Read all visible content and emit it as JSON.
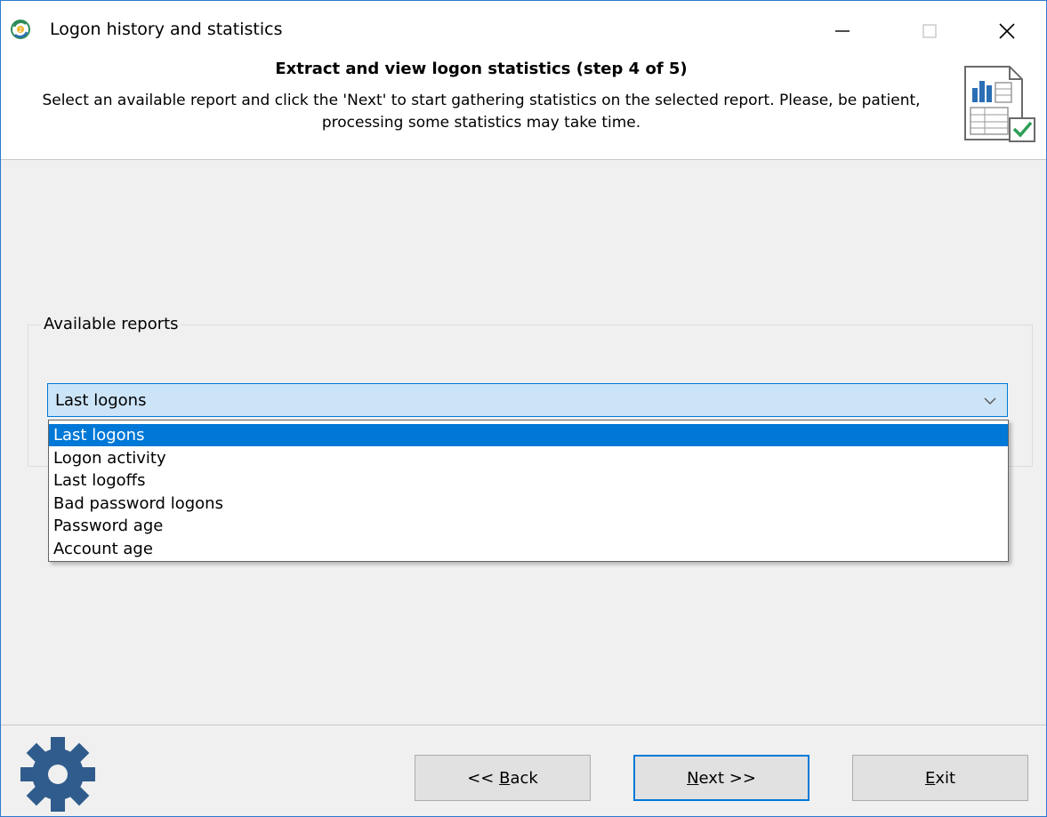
{
  "window": {
    "title": "Logon history and statistics",
    "controls": {
      "minimize": "minimize-icon",
      "maximize": "maximize-icon",
      "close": "close-icon"
    }
  },
  "header": {
    "title": "Extract and view logon statistics (step 4 of 5)",
    "description": "Select an available report and click the 'Next' to start gathering statistics on the selected report. Please, be patient, processing some statistics may take time.",
    "icon": "report-checked-icon"
  },
  "reports": {
    "group_label": "Available reports",
    "selected": "Last logons",
    "options": [
      "Last logons",
      "Logon activity",
      "Last logoffs",
      "Bad password logons",
      "Password age",
      "Account age"
    ],
    "highlighted_index": 0
  },
  "footer": {
    "back_prefix": "<< ",
    "back_accel": "B",
    "back_rest": "ack",
    "next_accel": "N",
    "next_rest": "ext >>",
    "exit_accel": "E",
    "exit_rest": "xit",
    "icon": "gear-icon"
  },
  "colors": {
    "accent": "#0078d7",
    "combo_bg": "#cce4f7",
    "gear": "#2f5c8c",
    "window_bg": "#f0f0f0"
  }
}
